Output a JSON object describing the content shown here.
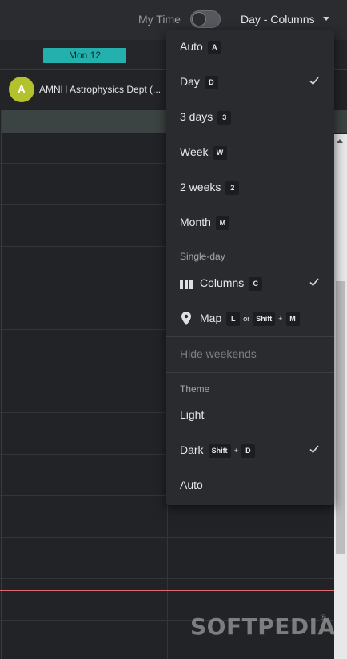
{
  "topbar": {
    "my_time_label": "My Time",
    "view_select_label": "Day - Columns"
  },
  "day_header": {
    "day_label": "Mon 12"
  },
  "resource": {
    "avatar_letter": "A",
    "name": "AMNH Astrophysics Dept (..."
  },
  "menu": {
    "items": [
      {
        "label": "Auto",
        "key": "A",
        "checked": false
      },
      {
        "label": "Day",
        "key": "D",
        "checked": true
      },
      {
        "label": "3 days",
        "key": "3",
        "checked": false
      },
      {
        "label": "Week",
        "key": "W",
        "checked": false
      },
      {
        "label": "2 weeks",
        "key": "2",
        "checked": false
      },
      {
        "label": "Month",
        "key": "M",
        "checked": false
      }
    ],
    "single_day": {
      "heading": "Single-day",
      "columns": {
        "label": "Columns",
        "key": "C",
        "icon": "columns-icon",
        "checked": true
      },
      "map": {
        "label": "Map",
        "key1": "L",
        "or_text": "or",
        "key2": "Shift",
        "plus": "+",
        "key3": "M",
        "icon": "map-pin-icon"
      }
    },
    "hide_weekends": "Hide weekends",
    "theme": {
      "heading": "Theme",
      "light": "Light",
      "dark": {
        "label": "Dark",
        "key1": "Shift",
        "plus": "+",
        "key2": "D",
        "checked": true
      },
      "auto": "Auto"
    }
  },
  "watermark": {
    "text": "SOFTPEDIA",
    "reg": "®"
  },
  "colors": {
    "accent_teal": "#24b1ad",
    "avatar_green": "#b3c22a",
    "now_line": "#e06a72",
    "background": "#212226"
  }
}
